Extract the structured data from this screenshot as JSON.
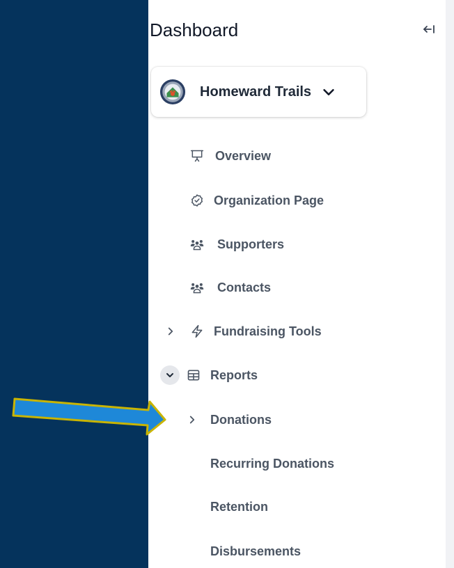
{
  "header": {
    "title": "Dashboard",
    "collapse_icon": "collapse-left-icon"
  },
  "org_switcher": {
    "name": "Homeward Trails",
    "logo_icon": "org-logo-icon",
    "chevron_icon": "chevron-down-icon"
  },
  "nav": {
    "overview": {
      "label": "Overview",
      "icon": "presentation-icon"
    },
    "organization_page": {
      "label": "Organization Page",
      "icon": "badge-check-icon"
    },
    "supporters": {
      "label": "Supporters",
      "icon": "users-icon"
    },
    "contacts": {
      "label": "Contacts",
      "icon": "users-icon"
    },
    "fundraising_tools": {
      "label": "Fundraising Tools",
      "icon": "lightning-icon",
      "expanded": false
    },
    "reports": {
      "label": "Reports",
      "icon": "table-icon",
      "expanded": true,
      "children": {
        "donations": {
          "label": "Donations",
          "expanded": false
        },
        "recurring_donations": {
          "label": "Recurring Donations"
        },
        "retention": {
          "label": "Retention"
        },
        "disbursements": {
          "label": "Disbursements"
        }
      }
    }
  },
  "colors": {
    "background_navy": "#05335c",
    "sidebar_bg": "#ffffff",
    "nav_text": "#4b5563",
    "annotation_arrow_fill": "#1e88d8",
    "annotation_arrow_stroke": "#c9b400"
  }
}
